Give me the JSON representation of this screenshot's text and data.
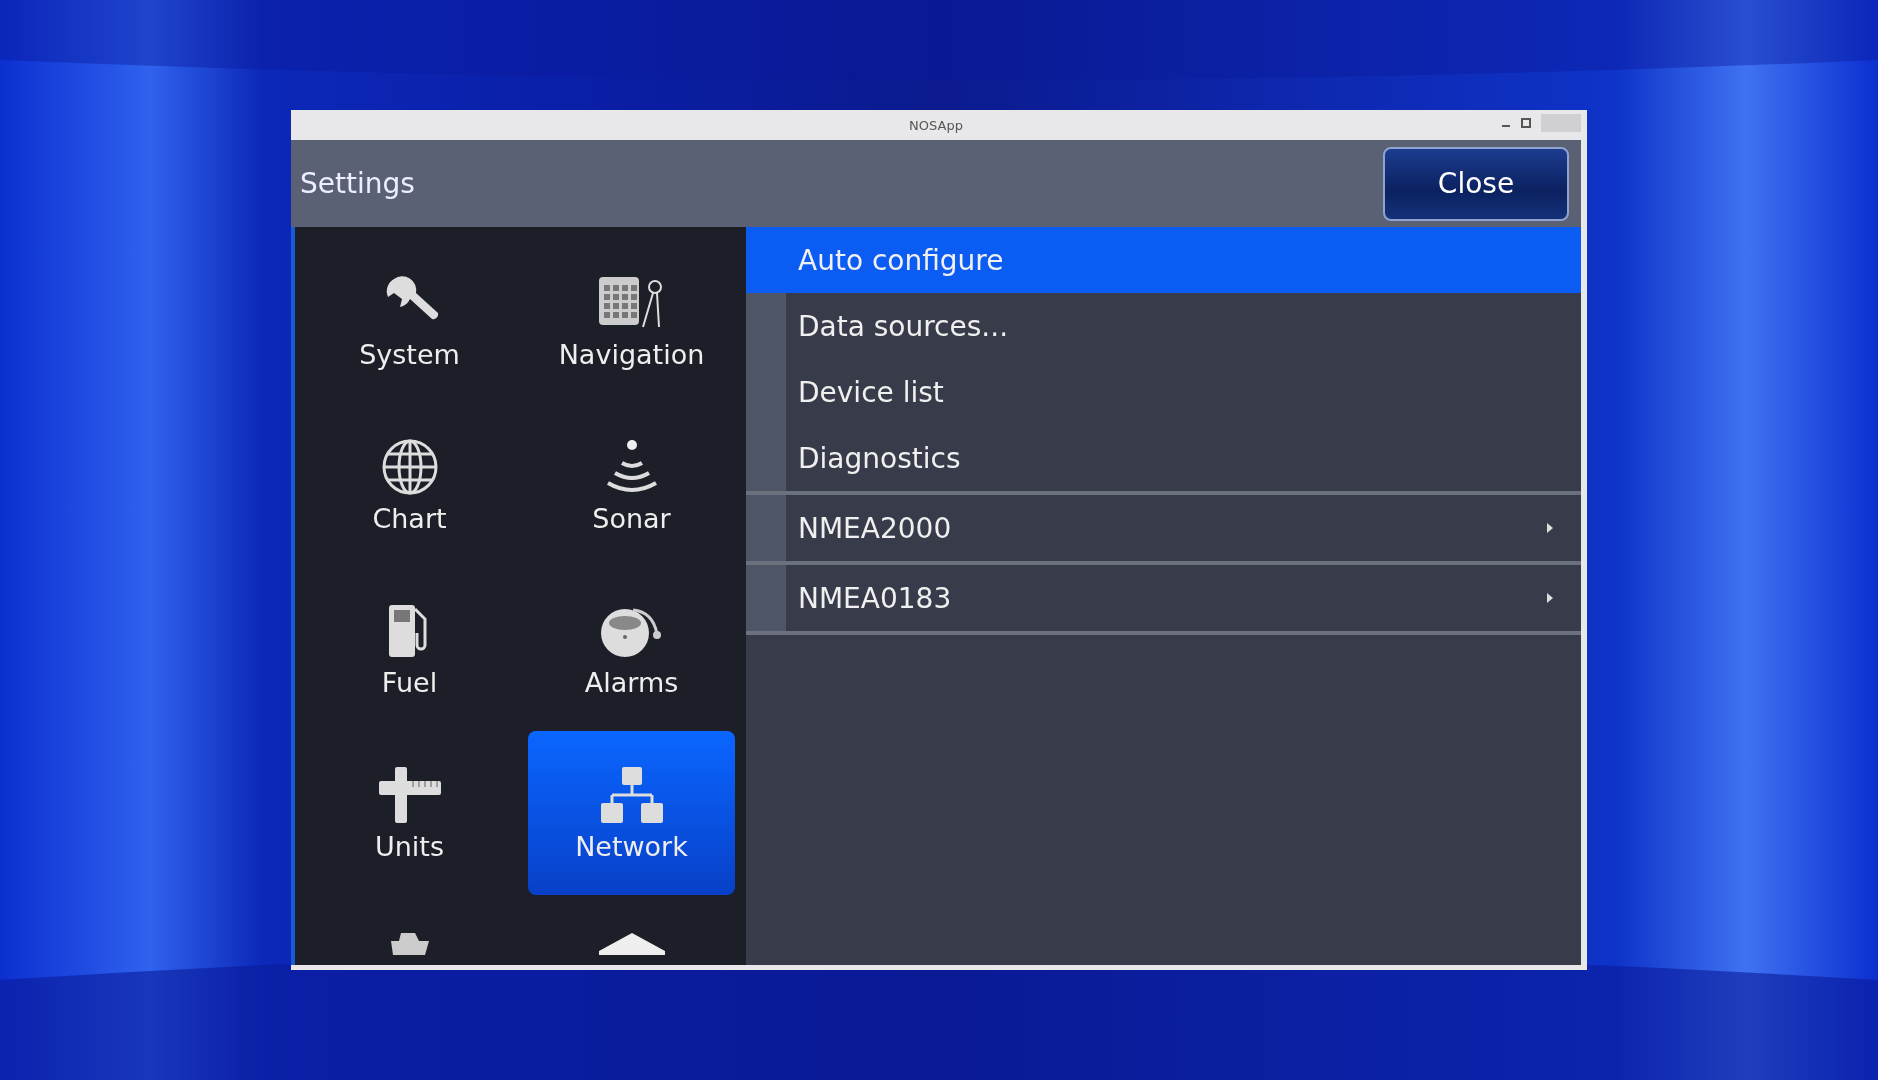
{
  "window": {
    "title": "NOSApp"
  },
  "header": {
    "title": "Settings",
    "close_button": "Close"
  },
  "sidebar": {
    "items": [
      {
        "label": "System",
        "selected": false
      },
      {
        "label": "Navigation",
        "selected": false
      },
      {
        "label": "Chart",
        "selected": false
      },
      {
        "label": "Sonar",
        "selected": false
      },
      {
        "label": "Fuel",
        "selected": false
      },
      {
        "label": "Alarms",
        "selected": false
      },
      {
        "label": "Units",
        "selected": false
      },
      {
        "label": "Network",
        "selected": true
      }
    ]
  },
  "menu": {
    "sections": [
      {
        "items": [
          {
            "label": "Auto configure",
            "kind": "action",
            "selected": true
          },
          {
            "label": "Data sources...",
            "kind": "action",
            "selected": false
          },
          {
            "label": "Device list",
            "kind": "action",
            "selected": false
          },
          {
            "label": "Diagnostics",
            "kind": "action",
            "selected": false
          }
        ]
      },
      {
        "items": [
          {
            "label": "NMEA2000",
            "kind": "submenu",
            "selected": false
          }
        ]
      },
      {
        "items": [
          {
            "label": "NMEA0183",
            "kind": "submenu",
            "selected": false
          }
        ]
      }
    ]
  }
}
